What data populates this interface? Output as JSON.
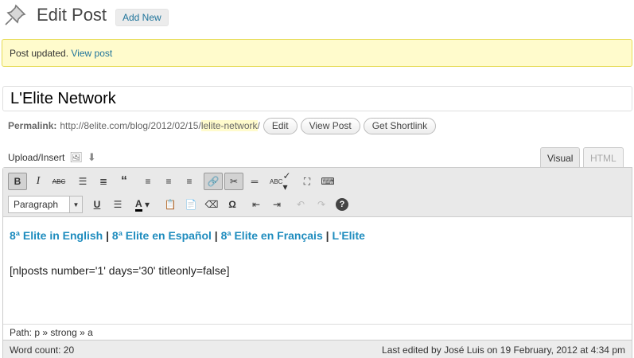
{
  "header": {
    "title": "Edit Post",
    "add_new": "Add New"
  },
  "notice": {
    "text": "Post updated.",
    "link": "View post"
  },
  "post": {
    "title": "L'Elite Network"
  },
  "permalink": {
    "label": "Permalink:",
    "base": "http://8elite.com/blog/2012/02/15/",
    "slug": "lelite-network",
    "trail": "/",
    "edit": "Edit",
    "view": "View Post",
    "shortlink": "Get Shortlink"
  },
  "media": {
    "label": "Upload/Insert"
  },
  "tabs": {
    "visual": "Visual",
    "html": "HTML"
  },
  "toolbar": {
    "format": "Paragraph"
  },
  "content": {
    "link1": "8ª Elite in English",
    "sep1": " | ",
    "link2": "8ª Elite en Español",
    "sep2": " | ",
    "link3": "8ª Elite en Français",
    "sep3": " | ",
    "link4": "L'Elite",
    "shortcode": "[nlposts number='1' days='30' titleonly=false]"
  },
  "path": {
    "label": "Path:",
    "p": "p",
    "sep": " » ",
    "strong": "strong",
    "a": "a"
  },
  "status": {
    "word_count": "Word count: 20",
    "last_edited": "Last edited by José Luis on 19 February, 2012 at 4:34 pm"
  }
}
